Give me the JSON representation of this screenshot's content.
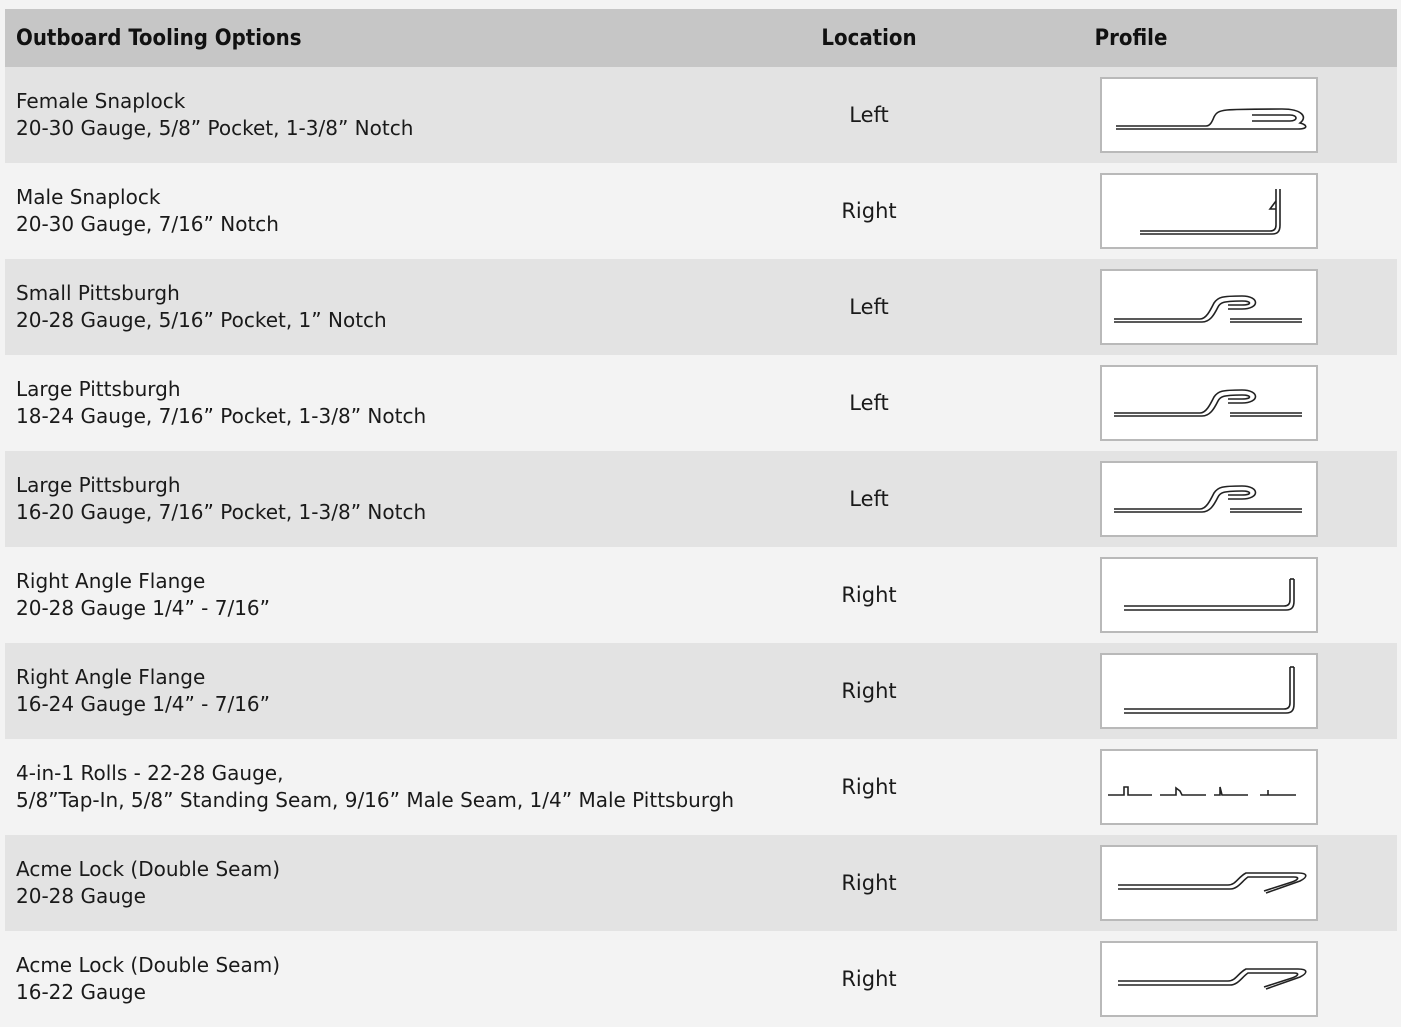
{
  "table": {
    "headers": {
      "option": "Outboard Tooling Options",
      "location": "Location",
      "profile": "Profile"
    },
    "rows": [
      {
        "name": "Female Snaplock",
        "spec": "20-30 Gauge, 5/8” Pocket, 1-3/8” Notch",
        "location": "Left",
        "profile_icon": "female-snaplock-profile-icon"
      },
      {
        "name": "Male Snaplock",
        "spec": "20-30 Gauge, 7/16” Notch",
        "location": "Right",
        "profile_icon": "male-snaplock-profile-icon"
      },
      {
        "name": "Small Pittsburgh",
        "spec": "20-28 Gauge, 5/16” Pocket, 1” Notch",
        "location": "Left",
        "profile_icon": "pittsburgh-profile-icon"
      },
      {
        "name": "Large Pittsburgh",
        "spec": "18-24 Gauge, 7/16” Pocket, 1-3/8” Notch",
        "location": "Left",
        "profile_icon": "pittsburgh-profile-icon"
      },
      {
        "name": "Large Pittsburgh",
        "spec": "16-20 Gauge, 7/16” Pocket, 1-3/8” Notch",
        "location": "Left",
        "profile_icon": "pittsburgh-profile-icon"
      },
      {
        "name": "Right Angle Flange",
        "spec": "20-28 Gauge 1/4” - 7/16”",
        "location": "Right",
        "profile_icon": "right-angle-flange-profile-icon"
      },
      {
        "name": "Right Angle Flange",
        "spec": "16-24 Gauge 1/4” - 7/16”",
        "location": "Right",
        "profile_icon": "right-angle-flange-profile-icon"
      },
      {
        "name": "4-in-1 Rolls - 22-28 Gauge,",
        "spec": "5/8”Tap-In, 5/8” Standing Seam, 9/16” Male Seam, 1/4” Male Pittsburgh",
        "location": "Right",
        "profile_icon": "four-in-one-profile-icon"
      },
      {
        "name": "Acme Lock (Double Seam)",
        "spec": "20-28 Gauge",
        "location": "Right",
        "profile_icon": "acme-lock-profile-icon"
      },
      {
        "name": "Acme Lock (Double Seam)",
        "spec": "16-22 Gauge",
        "location": "Right",
        "profile_icon": "acme-lock-profile-icon"
      }
    ]
  },
  "colors": {
    "header_bg": "#c6c6c6",
    "row_shaded": "#e3e3e3",
    "row_plain": "#f3f3f3",
    "profile_border": "#b9b9b9"
  }
}
